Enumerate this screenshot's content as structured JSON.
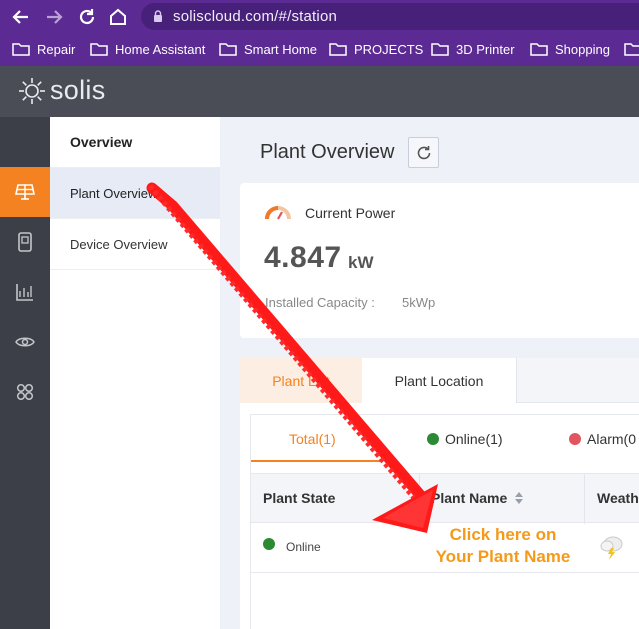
{
  "browser": {
    "url": "soliscloud.com/#/station",
    "bookmarks": [
      "Repair",
      "Home Assistant",
      "Smart Home",
      "PROJECTS",
      "3D Printer",
      "Shopping"
    ]
  },
  "app": {
    "logo_text": "solis"
  },
  "sidebar": {
    "icons": [
      "plant-icon",
      "device-icon",
      "chart-icon",
      "eye-icon",
      "apps-icon"
    ],
    "active_index": 0
  },
  "submenu": {
    "heading": "Overview",
    "items": [
      {
        "label": "Plant Overview",
        "active": true
      },
      {
        "label": "Device Overview",
        "active": false
      }
    ]
  },
  "main": {
    "title": "Plant Overview",
    "power": {
      "label": "Current Power",
      "value": "4.847",
      "unit": "kW",
      "capacity_label": "Installed Capacity :",
      "capacity_value": "5kWp"
    },
    "tabs": [
      {
        "label": "Plant List",
        "active": true
      },
      {
        "label": "Plant Location",
        "active": false
      }
    ],
    "status_filters": {
      "total": "Total(1)",
      "online": "Online(1)",
      "alarm": "Alarm(0"
    },
    "table": {
      "headers": [
        "Plant State",
        "Plant Name",
        "Weath"
      ],
      "rows": [
        {
          "state": "Online"
        }
      ]
    }
  },
  "annotation": {
    "line1": "Click here on",
    "line2": "Your Plant Name"
  },
  "colors": {
    "accent": "#f58220",
    "online": "#2c8a34",
    "alarm": "#e05561",
    "annotation_arrow": "#ff1a1a",
    "browser": "#5b2b93"
  }
}
